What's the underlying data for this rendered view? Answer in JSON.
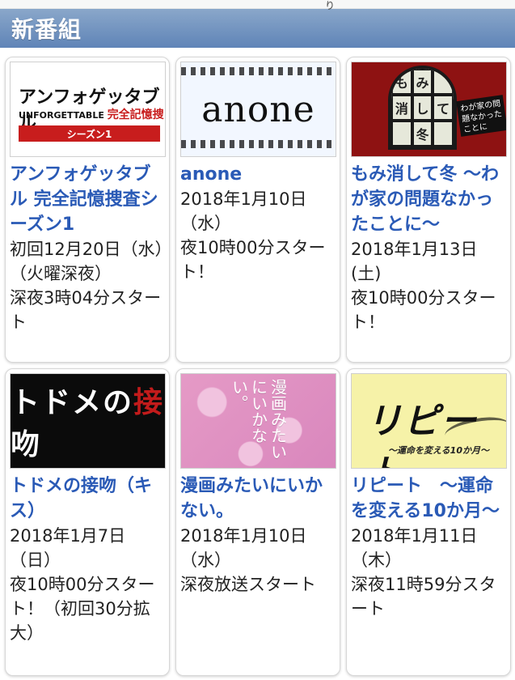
{
  "top_mark": "り",
  "section": {
    "title": "新番組"
  },
  "programs": [
    {
      "title": "アンフォゲッタブル 完全記憶捜査シーズン1",
      "info": "初回12月20日（水）（火曜深夜）\n深夜3時04分スタート",
      "thumbnail": {
        "icon": "unforgettable-poster",
        "line1": "アンフォゲッタブル",
        "line2_left": "UNFORGETTABLE",
        "line2_right": "完全記憶捜査",
        "badge": "シーズン1"
      }
    },
    {
      "title": "anone",
      "info": "2018年1月10日（水）\n夜10時00分スタート！",
      "thumbnail": {
        "icon": "anone-poster",
        "logo": "anone"
      }
    },
    {
      "title": "もみ消して冬 〜わが家の問題なかったことに〜",
      "info": "2018年1月13日(土)\n夜10時00分スタート！",
      "thumbnail": {
        "icon": "momikeshite-poster",
        "window_chars": [
          "も",
          "み",
          "",
          "消",
          "し",
          "て",
          "",
          "冬",
          ""
        ],
        "sign": "わが家の問題なかったことに"
      }
    },
    {
      "title": "トドメの接吻（キス）",
      "info": "2018年1月7日（日）\n夜10時00分スタート！（初回30分拡大）",
      "thumbnail": {
        "icon": "todome-poster",
        "logo_left": "トドメの",
        "logo_red": "接",
        "logo_right": "吻"
      }
    },
    {
      "title": "漫画みたいにいかない。",
      "info": "2018年1月10日（水）\n深夜放送スタート",
      "thumbnail": {
        "icon": "manga-poster",
        "vertical_text": "漫画みたいにいかない。"
      }
    },
    {
      "title": "リピート　〜運命を変える10か月〜",
      "info": "2018年1月11日（木）\n深夜11時59分スタート",
      "thumbnail": {
        "icon": "repeat-poster",
        "logo": "リピート",
        "sub": "〜運命を変える10か月〜"
      }
    }
  ],
  "colors": {
    "header_gradient_top": "#8aa7ca",
    "header_gradient_bottom": "#5f84b7",
    "title_link": "#2a5ab6"
  }
}
